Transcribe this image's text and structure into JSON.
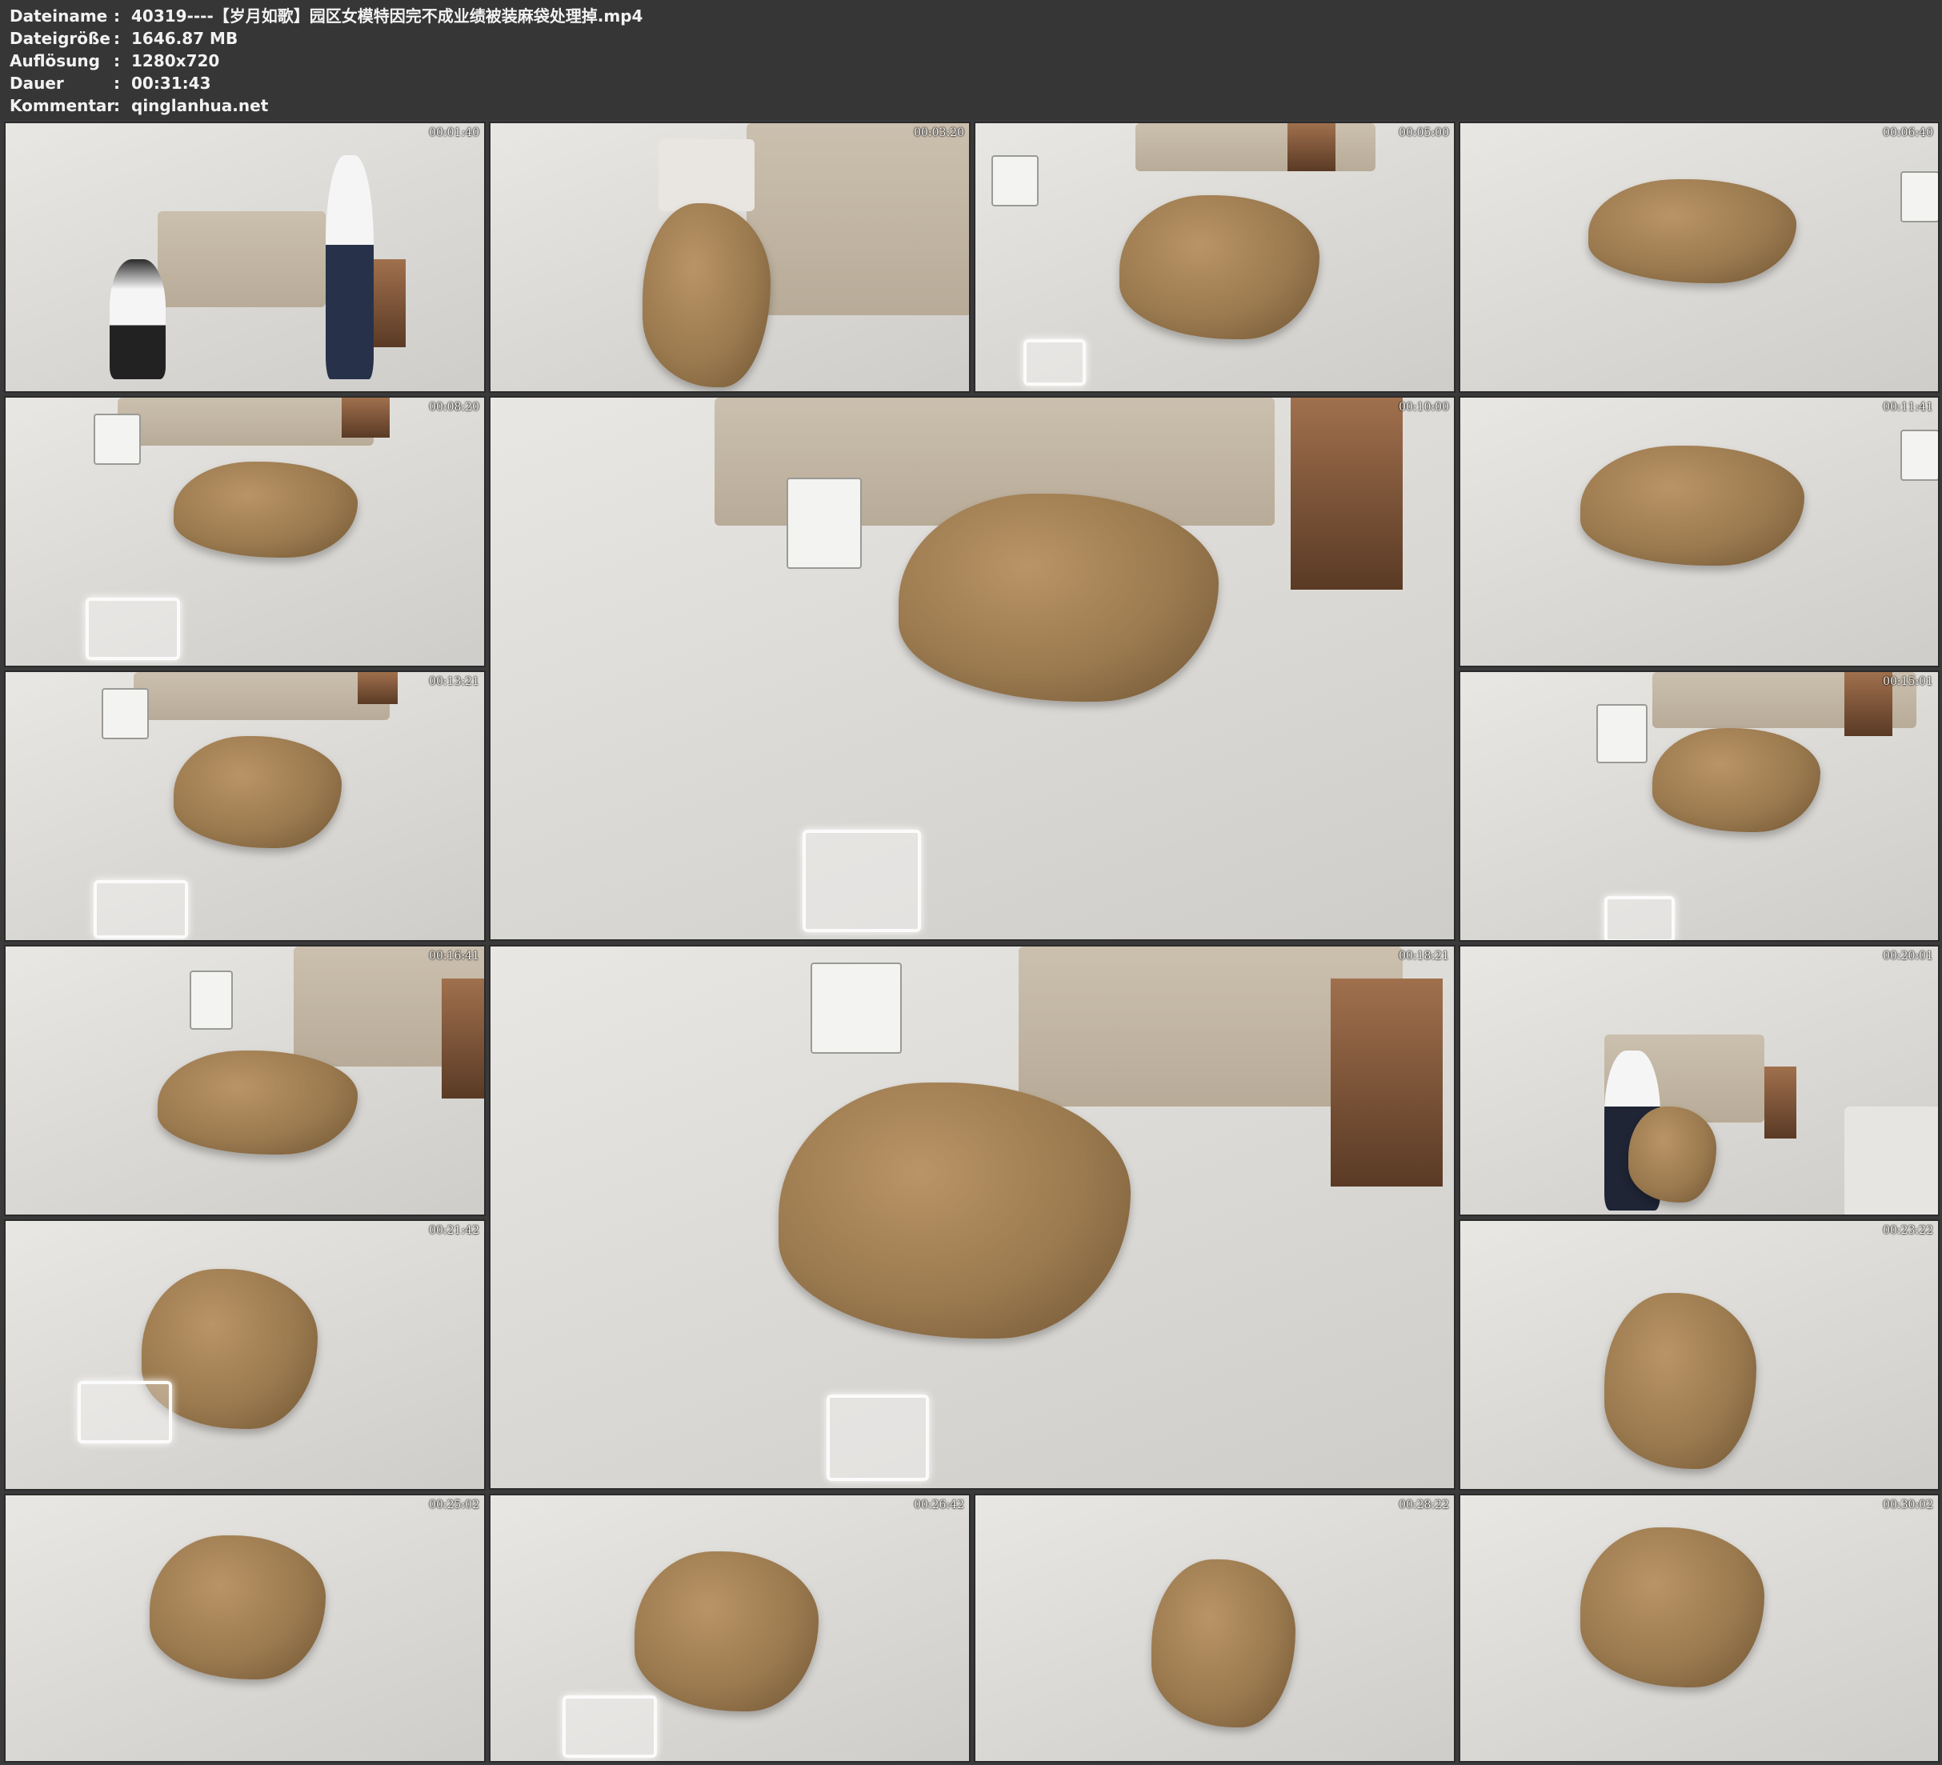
{
  "info": {
    "rows": [
      {
        "key": "Dateiname",
        "value": "40319----【岁月如歌】园区女模特因完不成业绩被装麻袋处理掉.mp4"
      },
      {
        "key": "Dateigröße",
        "value": "1646.87 MB"
      },
      {
        "key": "Auflösung",
        "value": "1280x720"
      },
      {
        "key": "Dauer",
        "value": "00:31:43"
      },
      {
        "key": "Kommentar",
        "value": "qinglanhua.net"
      }
    ],
    "separator": ":"
  },
  "thumbnails": [
    {
      "timestamp": "00:01:40"
    },
    {
      "timestamp": "00:03:20"
    },
    {
      "timestamp": "00:05:00"
    },
    {
      "timestamp": "00:06:40"
    },
    {
      "timestamp": "00:08:20"
    },
    {
      "timestamp": "00:10:00"
    },
    {
      "timestamp": "00:11:41"
    },
    {
      "timestamp": "00:13:21"
    },
    {
      "timestamp": "00:15:01"
    },
    {
      "timestamp": "00:16:41"
    },
    {
      "timestamp": "00:18:21"
    },
    {
      "timestamp": "00:20:01"
    },
    {
      "timestamp": "00:21:42"
    },
    {
      "timestamp": "00:23:22"
    },
    {
      "timestamp": "00:25:02"
    },
    {
      "timestamp": "00:26:42"
    },
    {
      "timestamp": "00:28:22"
    },
    {
      "timestamp": "00:30:02"
    }
  ]
}
